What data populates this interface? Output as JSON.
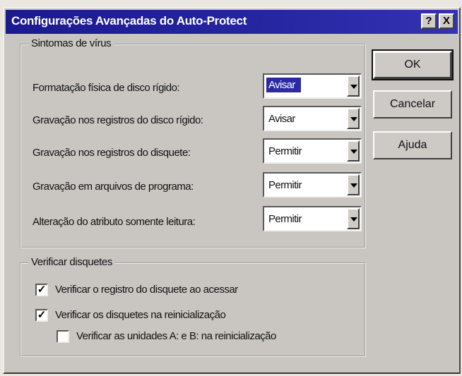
{
  "window": {
    "title": "Configurações Avançadas do Auto-Protect",
    "help_label": "?",
    "close_label": "X"
  },
  "symptoms": {
    "legend": "Sintomas de vírus",
    "rows": [
      {
        "label": "Formatação física de disco rígido:",
        "value": "Avisar"
      },
      {
        "label": "Gravação nos registros do disco rígido:",
        "value": "Avisar"
      },
      {
        "label": "Gravação nos registros do disquete:",
        "value": "Permitir"
      },
      {
        "label": "Gravação em arquivos de programa:",
        "value": "Permitir"
      },
      {
        "label": "Alteração do atributo somente leitura:",
        "value": "Permitir"
      }
    ]
  },
  "buttons": {
    "ok": "OK",
    "cancel": "Cancelar",
    "help": "Ajuda"
  },
  "floppy": {
    "legend": "Verificar disquetes",
    "options": [
      {
        "label": "Verificar o registro do disquete ao acessar",
        "checked": true,
        "mark": "✓"
      },
      {
        "label": "Verificar os disquetes na reinicialização",
        "checked": true,
        "mark": "✓"
      },
      {
        "label": "Verificar as unidades A: e B: na reinicialização",
        "checked": false,
        "mark": ""
      }
    ]
  }
}
